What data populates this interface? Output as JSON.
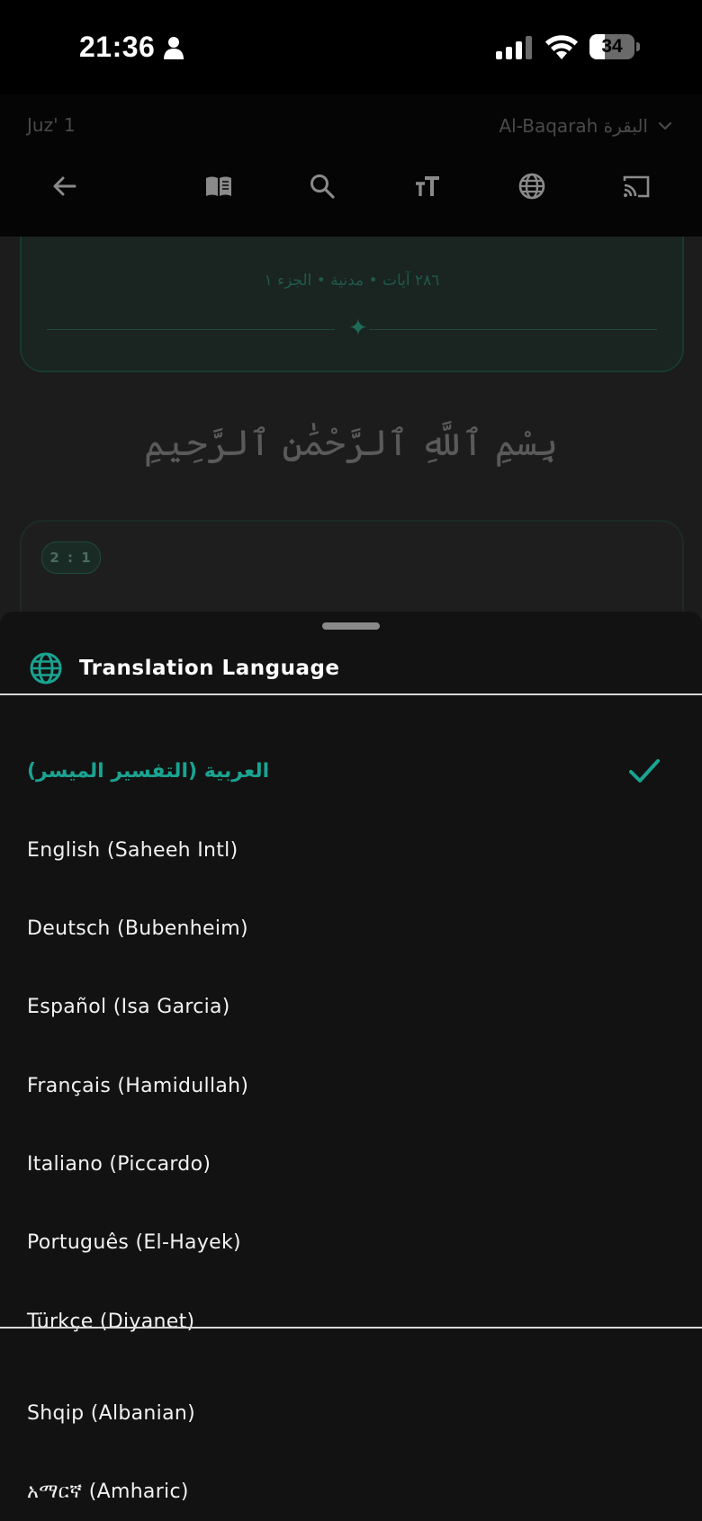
{
  "status_bar": {
    "time": "21:36",
    "battery": "34"
  },
  "header": {
    "juz": "Juz' 1",
    "surah": "Al-Baqarah البقرة"
  },
  "background": {
    "surah_meta": "٢٨٦ آيات • مدنية • الجزء ١",
    "basmala": "بِسْمِ ٱللَّهِ ٱلرَّحْمَٰنِ ٱلرَّحِيمِ",
    "ayah_badge": "2 : 1"
  },
  "sheet": {
    "title": "Translation Language",
    "selected_index": 0,
    "languages": [
      "العربية (التفسير الميسر)",
      "English (Saheeh Intl)",
      "Deutsch (Bubenheim)",
      "Español (Isa Garcia)",
      "Français (Hamidullah)",
      "Italiano (Piccardo)",
      "Português (El-Hayek)",
      "Türkçe (Diyanet)",
      "Shqip (Albanian)",
      "አማርኛ (Amharic)"
    ]
  },
  "colors": {
    "accent": "#1aa391",
    "sheet_bg": "#121212",
    "header_bg": "#050505"
  }
}
